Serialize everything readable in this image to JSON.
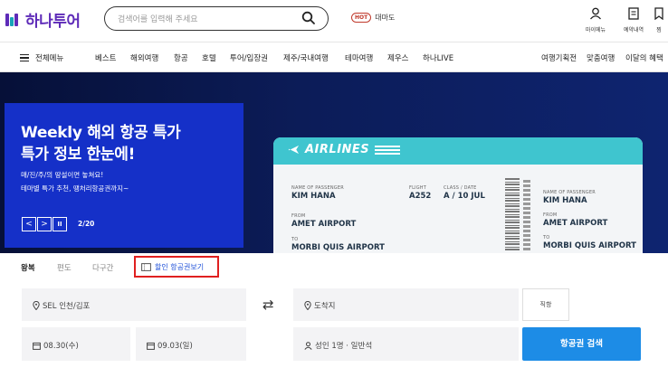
{
  "colors": {
    "brand": "#5e2bb8",
    "accent_blue": "#1d8ce6",
    "highlight_red": "#e02020",
    "hero_panel": "#1530c8",
    "ticket_teal": "#3fc5cf"
  },
  "header": {
    "logo_text": "하나투어",
    "search": {
      "placeholder": "검색어를 입력해 주세요",
      "icon": "search-icon"
    },
    "hot_badge": "HOT",
    "hot_keyword": "대마도",
    "utils": [
      {
        "label": "마이메뉴",
        "icon": "user-icon"
      },
      {
        "label": "예약내역",
        "icon": "document-icon"
      },
      {
        "label": "찜",
        "icon": "bookmark-icon"
      }
    ]
  },
  "nav": {
    "all_menu": "전체메뉴",
    "items": [
      "베스트",
      "해외여행",
      "항공",
      "호텔",
      "투어/입장권",
      "제주/국내여행",
      "테마여행",
      "제우스",
      "하나LIVE"
    ],
    "right_items": [
      "여행기획전",
      "맞춤여행",
      "이달의 혜택"
    ]
  },
  "hero": {
    "title_line1": "Weekly 해외 항공 특가",
    "title_line2": "특가 정보 한눈에!",
    "sub_line1": "매/진/주/의 땅설이면 놓쳐요!",
    "sub_line2": "테마별 특가 추천, 땡처리항공권까지~",
    "counter": "2/20",
    "controls": {
      "prev": "<",
      "next": ">",
      "pause": "II"
    },
    "ticket": {
      "brand": "AIRLINES",
      "name_label": "NAME OF PASSENGER",
      "name": "KIM HANA",
      "flight_label": "FLIGHT",
      "flight": "A252",
      "class_label": "CLASS / DATE",
      "class_date": "A / 10 JUL",
      "from_label": "FROM",
      "from": "AMET AIRPORT",
      "to_label": "TO",
      "to": "MORBI QUIS AIRPORT",
      "stub_name_label": "NAME OF PASSENGER",
      "stub_name": "KIM HANA",
      "stub_from_label": "FROM",
      "stub_from": "AMET AIRPORT",
      "stub_to_label": "TO",
      "stub_to": "MORBI QUIS AIRPORT"
    }
  },
  "flight_search": {
    "tabs": [
      "왕복",
      "편도",
      "다구간"
    ],
    "active_tab": "왕복",
    "discount_link": "할인 항공권보기",
    "departure": "SEL 인천/김포",
    "arrival_placeholder": "도착지",
    "direct_label": "직항",
    "date_depart": "08.30(수)",
    "date_return": "09.03(일)",
    "passengers": "성인 1명 · 일반석",
    "search_button": "항공권 검색"
  }
}
